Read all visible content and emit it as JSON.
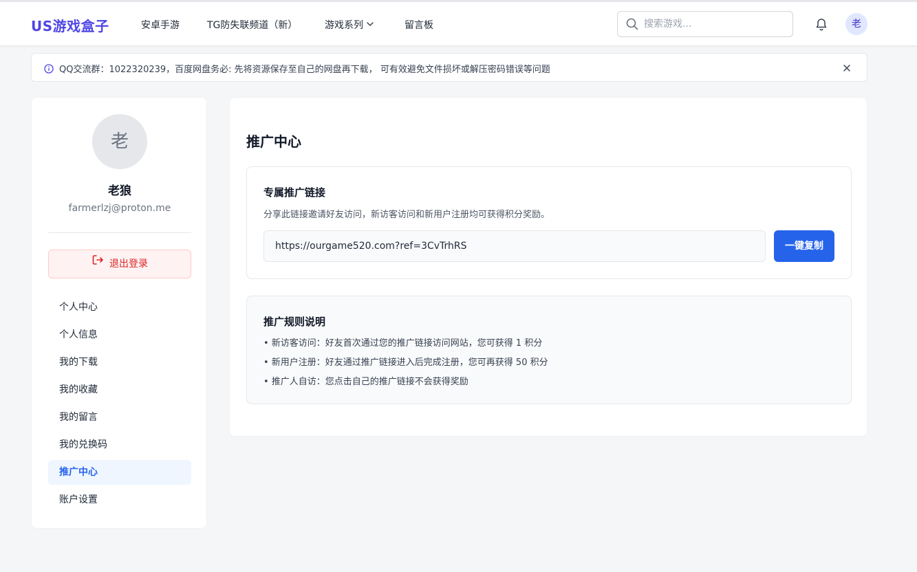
{
  "header": {
    "logo": "US游戏盒子",
    "nav": [
      "安卓手游",
      "TG防失联频道（新）",
      "游戏系列",
      "留言板"
    ],
    "search_placeholder": "搜索游戏...",
    "avatar_char": "老"
  },
  "notice": {
    "text": "QQ交流群：1022320239，百度网盘务必: 先将资源保存至自己的网盘再下载， 可有效避免文件损坏或解压密码错误等问题"
  },
  "sidebar": {
    "avatar_char": "老",
    "name": "老狼",
    "email": "farmerlzj@proton.me",
    "logout_label": "退出登录",
    "items": [
      {
        "label": "个人中心"
      },
      {
        "label": "个人信息"
      },
      {
        "label": "我的下载"
      },
      {
        "label": "我的收藏"
      },
      {
        "label": "我的留言"
      },
      {
        "label": "我的兑换码"
      },
      {
        "label": "推广中心"
      },
      {
        "label": "账户设置"
      }
    ],
    "active_item": "推广中心"
  },
  "main": {
    "title": "推广中心",
    "link_card": {
      "title": "专属推广链接",
      "desc": "分享此链接邀请好友访问，新访客访问和新用户注册均可获得积分奖励。",
      "link": "https://ourgame520.com?ref=3CvTrhRS",
      "copy_label": "一键复制"
    },
    "rules_card": {
      "title": "推广规则说明",
      "rules": [
        "• 新访客访问：好友首次通过您的推广链接访问网站，您可获得 1 积分",
        "• 新用户注册：好友通过推广链接进入后完成注册，您可再获得 50 积分",
        "• 推广人自访：您点击自己的推广链接不会获得奖励"
      ]
    }
  },
  "colors": {
    "brand": "#4f46e5",
    "primary": "#2563eb",
    "danger": "#dc2626"
  }
}
